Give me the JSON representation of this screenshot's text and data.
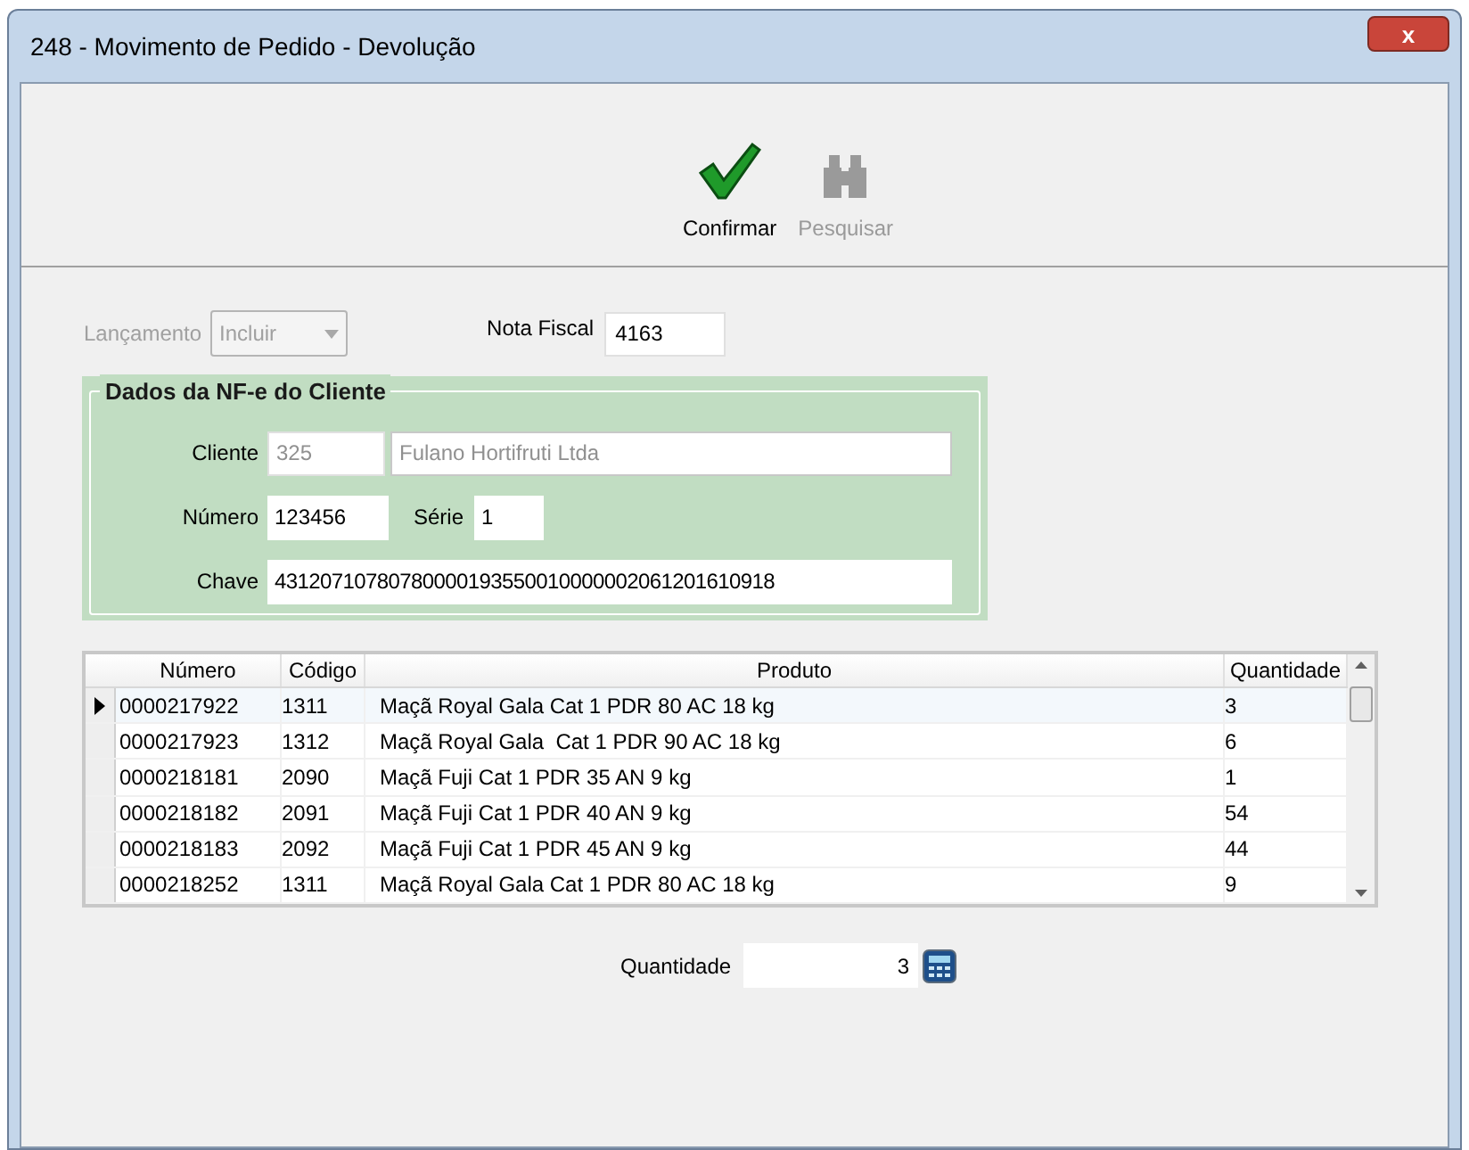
{
  "window": {
    "title": "248 - Movimento de Pedido - Devolução",
    "close": "x"
  },
  "toolbar": [
    {
      "kind": "confirm",
      "label": "Confirmar",
      "disabled": false
    },
    {
      "kind": "search",
      "label": "Pesquisar",
      "disabled": true
    }
  ],
  "lancamento": {
    "label": "Lançamento",
    "value": "Incluir",
    "disabled": true
  },
  "nota_fiscal": {
    "label": "Nota Fiscal",
    "value": "4163"
  },
  "group": {
    "title": "Dados da NF-e do Cliente",
    "cliente": {
      "label": "Cliente",
      "code": "325",
      "name": "Fulano Hortifruti Ltda",
      "disabled": true
    },
    "numero": {
      "label": "Número",
      "value": "123456"
    },
    "serie": {
      "label": "Série",
      "value": "1"
    },
    "chave": {
      "label": "Chave",
      "value": "43120710780780000193550010000002061201610918"
    }
  },
  "table": {
    "columns": [
      "Número",
      "Código",
      "Produto",
      "Quantidade"
    ],
    "rows": [
      {
        "cells": [
          "0000217922",
          "1311",
          "Maçã Royal Gala Cat 1 PDR 80 AC 18 kg",
          "3"
        ],
        "selected": true
      },
      {
        "cells": [
          "0000217923",
          "1312",
          "Maçã Royal Gala  Cat 1 PDR 90 AC 18 kg",
          "6"
        ],
        "selected": false
      },
      {
        "cells": [
          "0000218181",
          "2090",
          "Maçã Fuji Cat 1 PDR 35 AN 9 kg",
          "1"
        ],
        "selected": false
      },
      {
        "cells": [
          "0000218182",
          "2091",
          "Maçã Fuji Cat 1 PDR 40 AN 9 kg",
          "54"
        ],
        "selected": false
      },
      {
        "cells": [
          "0000218183",
          "2092",
          "Maçã Fuji Cat 1 PDR 45 AN 9 kg",
          "44"
        ],
        "selected": false
      },
      {
        "cells": [
          "0000218252",
          "1311",
          "Maçã Royal Gala Cat 1 PDR 80 AC 18 kg",
          "9"
        ],
        "selected": false
      }
    ]
  },
  "quantidade": {
    "label": "Quantidade",
    "value": "3"
  }
}
